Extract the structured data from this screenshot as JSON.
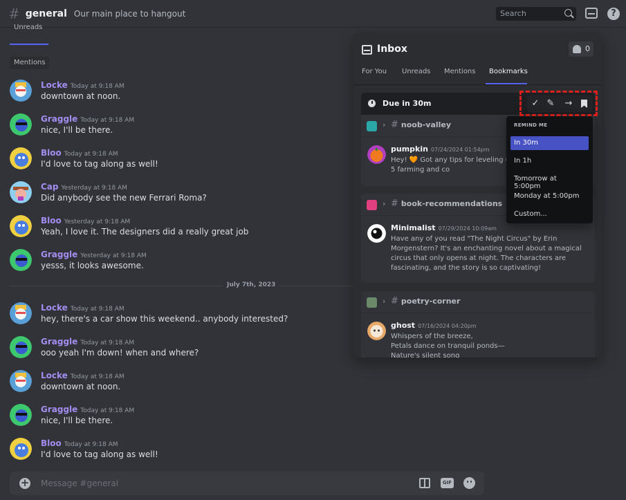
{
  "header": {
    "hash": "#",
    "channel": "general",
    "topic": "Our main place to hangout",
    "search_placeholder": "Search",
    "help": "?"
  },
  "chat": {
    "tab_unreads": "Unreads",
    "mentions_label": "Mentions",
    "divider_label": "July 7th, 2023",
    "messages": [
      {
        "author": "Locke",
        "time": "Today at 9:18 AM",
        "text": "downtown at noon."
      },
      {
        "author": "Graggle",
        "time": "Today at 9:18 AM",
        "text": "nice, I'll be there."
      },
      {
        "author": "Bloo",
        "time": "Today at 9:18 AM",
        "text": "I'd love to tag along as well!"
      },
      {
        "author": "Cap",
        "time": "Yesterday at 9:18 AM",
        "text": "Did anybody see the new Ferrari Roma?"
      },
      {
        "author": "Bloo",
        "time": "Yesterday at 9:18 AM",
        "text": "Yeah, I love it. The designers did a really great job"
      },
      {
        "author": "Graggle",
        "time": "Yesterday at 9:18 AM",
        "text": "yesss, it looks awesome."
      },
      {
        "author": "Locke",
        "time": "Today at 9:18 AM",
        "text": "hey, there's a car show this weekend.. anybody interested?"
      },
      {
        "author": "Graggle",
        "time": "Today at 9:18 AM",
        "text": "ooo yeah I'm down! when and where?"
      },
      {
        "author": "Locke",
        "time": "Today at 9:18 AM",
        "text": "downtown at noon."
      },
      {
        "author": "Graggle",
        "time": "Today at 9:18 AM",
        "text": "nice, I'll be there."
      },
      {
        "author": "Bloo",
        "time": "Today at 9:18 AM",
        "text": "I'd love to tag along as well!"
      }
    ],
    "composer_placeholder": "Message #general",
    "composer_plus": "+",
    "gif_label": "GIF"
  },
  "inbox": {
    "title": "Inbox",
    "badge_count": "0",
    "tabs": [
      "For You",
      "Unreads",
      "Mentions",
      "Bookmarks"
    ],
    "due_label": "Due in 30m",
    "cards": [
      {
        "channel": "noob-valley",
        "author": "pumpkin",
        "date": "07/24/2024 01:54pm",
        "text": "Hey! 🧡 Got any tips for leveling up? I'm stuck on level 5 farming and co"
      },
      {
        "channel": "book-recommendations",
        "author": "Minimalist",
        "date": "07/29/2024 10:09am",
        "text": "Have any of you read \"The Night Circus\" by Erin Morgenstern? It's an enchanting novel about a magical circus that only opens at night. The characters are fascinating, and the story is so captivating!"
      },
      {
        "channel": "poetry-corner",
        "author": "ghost",
        "date": "07/16/2024 04:20pm",
        "text": "Whispers of the breeze,\nPetals dance on tranquil ponds—\nNature's silent song"
      }
    ]
  },
  "toolbar": {
    "check": "✓",
    "edit": "✎",
    "forward": "→"
  },
  "remind_menu": {
    "heading": "REMIND ME",
    "items": [
      "In 30m",
      "In 1h",
      "Tomorrow at 5:00pm",
      "Monday at 5:00pm",
      "Custom..."
    ]
  },
  "colors": {
    "accent": "#5865f2",
    "author": "#a48df0",
    "highlight": "#e0201b"
  }
}
